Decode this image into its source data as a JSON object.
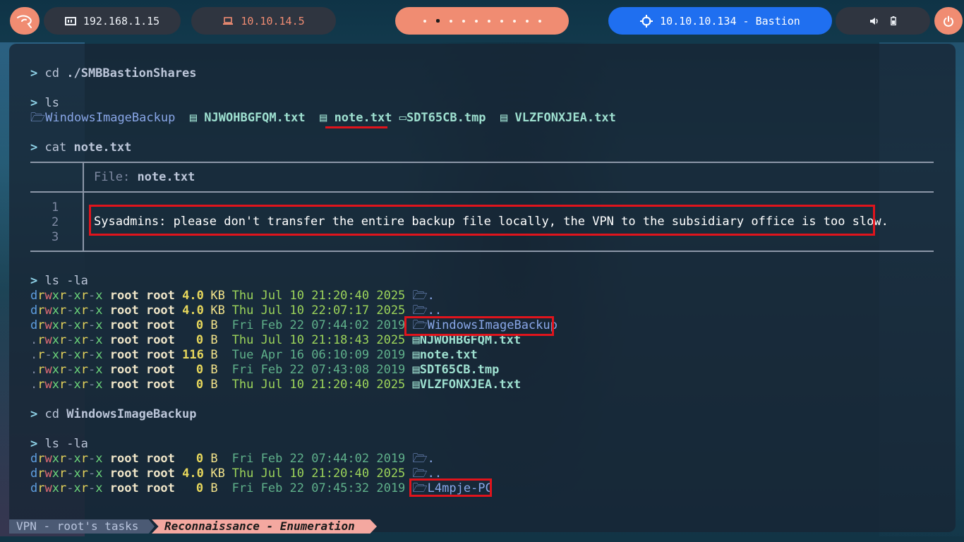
{
  "topbar": {
    "logo_icon": "kali-dragon-icon",
    "local_ip": "192.168.1.15",
    "vpn_ip": "10.10.14.5",
    "target": "10.10.10.134 - Bastion",
    "colors": {
      "accent": "#f08c72",
      "target_pill": "#1f6ff0",
      "dark_pill": "#2f3540"
    }
  },
  "terminal": {
    "l1": {
      "prompt": ">",
      "cmd": "cd",
      "arg": "./SMBBastionShares"
    },
    "l2": {
      "prompt": ">",
      "cmd": "ls"
    },
    "ls_items": [
      "WindowsImageBackup",
      "NJWOHBGFQM.txt",
      "note.txt",
      "SDT65CB.tmp",
      "VLZFONXJEA.txt"
    ],
    "l3": {
      "prompt": ">",
      "cmd": "cat",
      "arg": "note.txt"
    },
    "bat": {
      "file_label": "File:",
      "file_name": "note.txt",
      "line_numbers": [
        "1",
        "2",
        "3"
      ],
      "content": "Sysadmins: please don't transfer the entire backup file locally, the VPN to the subsidiary office is too slow."
    },
    "l4": {
      "prompt": ">",
      "cmd": "ls -la"
    },
    "la1": [
      {
        "perm": [
          "d",
          "r",
          "w",
          "x",
          "r",
          "-",
          "x",
          "r",
          "-",
          "x"
        ],
        "user": "root",
        "group": "root",
        "size": "4.0",
        "unit": "KB",
        "date": "Thu Jul 10 21:20:40 2025",
        "recent": true,
        "name": "."
      },
      {
        "perm": [
          "d",
          "r",
          "w",
          "x",
          "r",
          "-",
          "x",
          "r",
          "-",
          "x"
        ],
        "user": "root",
        "group": "root",
        "size": "4.0",
        "unit": "KB",
        "date": "Thu Jul 10 22:07:17 2025",
        "recent": true,
        "name": ".."
      },
      {
        "perm": [
          "d",
          "r",
          "w",
          "x",
          "r",
          "-",
          "x",
          "r",
          "-",
          "x"
        ],
        "user": "root",
        "group": "root",
        "size": "0",
        "unit": "B",
        "date": "Fri Feb 22 07:44:02 2019",
        "recent": false,
        "name": "WindowsImageBackup"
      },
      {
        "perm": [
          ".",
          "r",
          "w",
          "x",
          "r",
          "-",
          "x",
          "r",
          "-",
          "x"
        ],
        "user": "root",
        "group": "root",
        "size": "0",
        "unit": "B",
        "date": "Thu Jul 10 21:18:43 2025",
        "recent": true,
        "name": "NJWOHBGFQM.txt"
      },
      {
        "perm": [
          ".",
          "r",
          "-",
          "x",
          "r",
          "-",
          "x",
          "r",
          "-",
          "x"
        ],
        "user": "root",
        "group": "root",
        "size": "116",
        "unit": "B",
        "date": "Tue Apr 16 06:10:09 2019",
        "recent": false,
        "name": "note.txt"
      },
      {
        "perm": [
          ".",
          "r",
          "w",
          "x",
          "r",
          "-",
          "x",
          "r",
          "-",
          "x"
        ],
        "user": "root",
        "group": "root",
        "size": "0",
        "unit": "B",
        "date": "Fri Feb 22 07:43:08 2019",
        "recent": false,
        "name": "SDT65CB.tmp"
      },
      {
        "perm": [
          ".",
          "r",
          "w",
          "x",
          "r",
          "-",
          "x",
          "r",
          "-",
          "x"
        ],
        "user": "root",
        "group": "root",
        "size": "0",
        "unit": "B",
        "date": "Thu Jul 10 21:20:40 2025",
        "recent": true,
        "name": "VLZFONXJEA.txt"
      }
    ],
    "l5": {
      "prompt": ">",
      "cmd": "cd",
      "arg": "WindowsImageBackup"
    },
    "l6": {
      "prompt": ">",
      "cmd": "ls -la"
    },
    "la2": [
      {
        "perm": [
          "d",
          "r",
          "w",
          "x",
          "r",
          "-",
          "x",
          "r",
          "-",
          "x"
        ],
        "user": "root",
        "group": "root",
        "size": "0",
        "unit": "B",
        "date": "Fri Feb 22 07:44:02 2019",
        "recent": false,
        "name": "."
      },
      {
        "perm": [
          "d",
          "r",
          "w",
          "x",
          "r",
          "-",
          "x",
          "r",
          "-",
          "x"
        ],
        "user": "root",
        "group": "root",
        "size": "4.0",
        "unit": "KB",
        "date": "Thu Jul 10 21:20:40 2025",
        "recent": true,
        "name": ".."
      },
      {
        "perm": [
          "d",
          "r",
          "w",
          "x",
          "r",
          "-",
          "x",
          "r",
          "-",
          "x"
        ],
        "user": "root",
        "group": "root",
        "size": "0",
        "unit": "B",
        "date": "Fri Feb 22 07:45:32 2019",
        "recent": false,
        "name": "L4mpje-PC"
      }
    ]
  },
  "statusbar": {
    "session": "VPN - root's tasks",
    "phase": "Reconnaissance - Enumeration"
  }
}
